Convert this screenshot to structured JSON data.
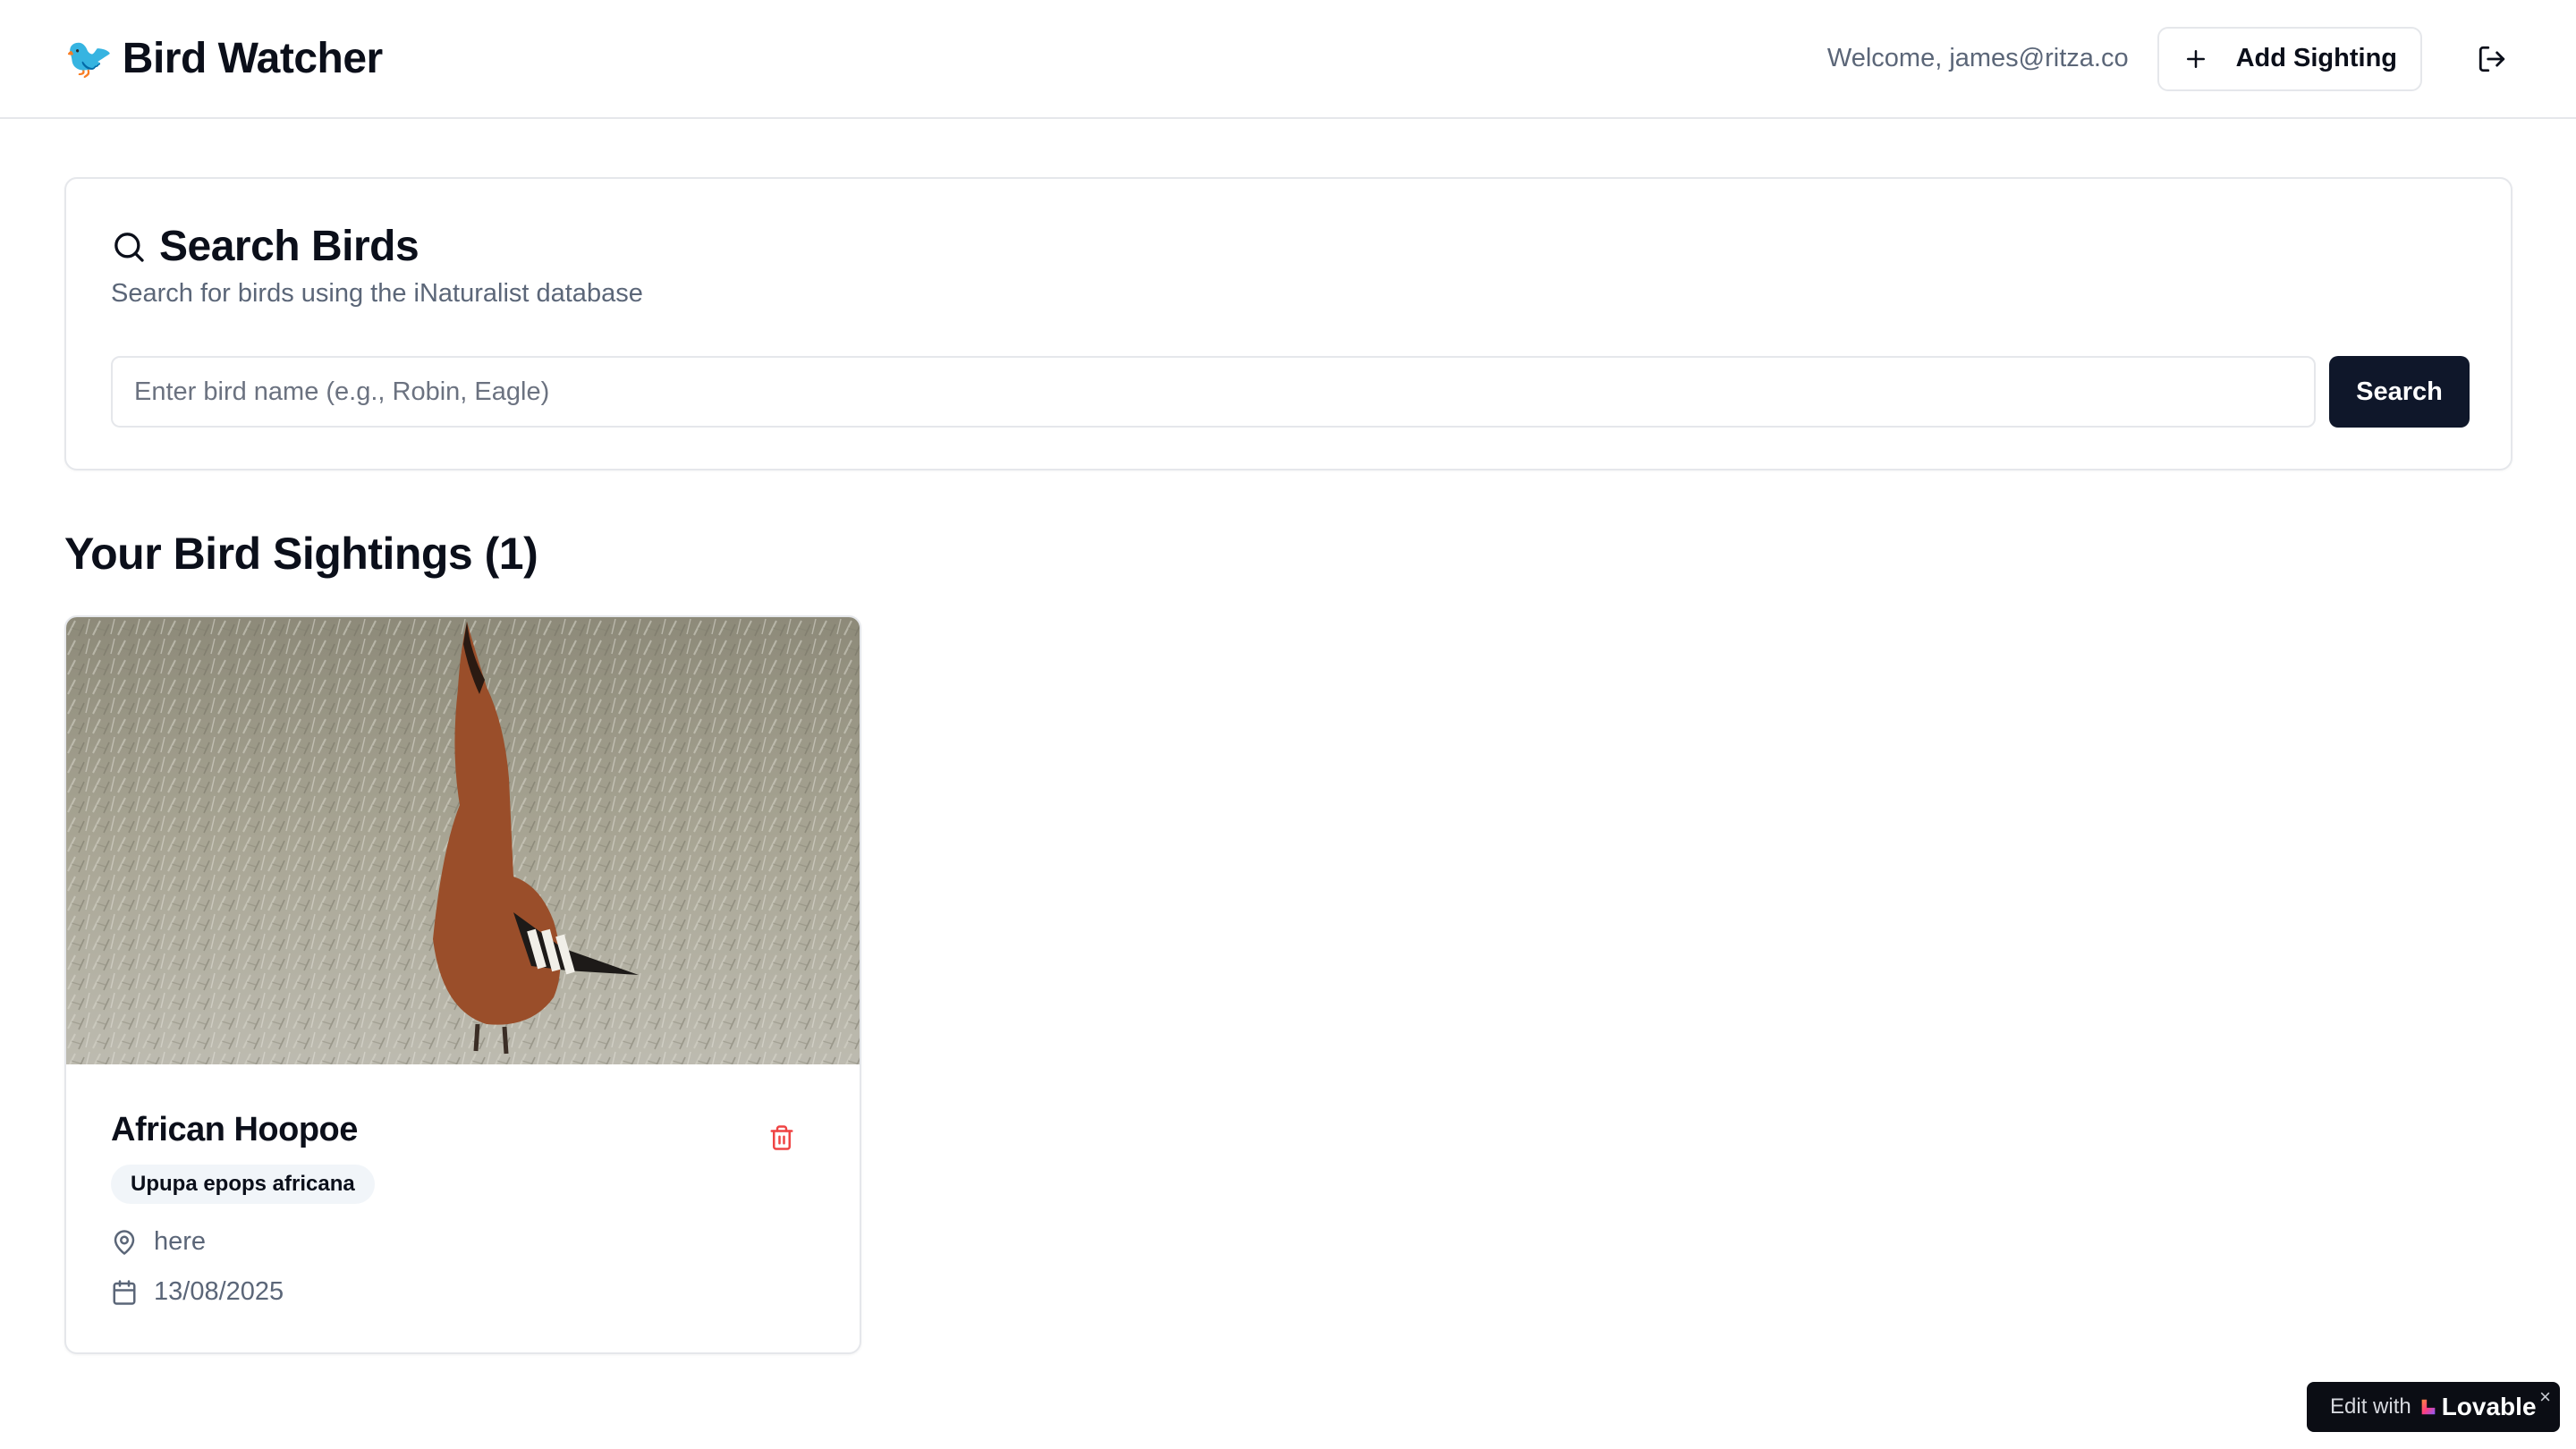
{
  "header": {
    "brand_emoji": "🐦",
    "title": "Bird Watcher",
    "welcome": "Welcome, james@ritza.co",
    "add_sighting_label": "Add Sighting",
    "icons": {
      "add": "plus-icon",
      "logout": "logout-icon"
    }
  },
  "search": {
    "title": "Search Birds",
    "subtitle": "Search for birds using the iNaturalist database",
    "placeholder": "Enter bird name (e.g., Robin, Eagle)",
    "value": "",
    "button_label": "Search",
    "icon": "search-icon"
  },
  "sightings": {
    "heading": "Your Bird Sightings (1)",
    "items": [
      {
        "common_name": "African Hoopoe",
        "scientific_name": "Upupa epops africana",
        "location": "here",
        "date": "13/08/2025",
        "photo": "hoopoe-on-grass-photo",
        "icons": {
          "delete": "trash-icon",
          "location": "map-pin-icon",
          "date": "calendar-icon"
        }
      }
    ]
  },
  "badge": {
    "prefix": "Edit with",
    "brand": "Lovable",
    "close": "×"
  },
  "colors": {
    "primary": "#0f172a",
    "muted_text": "#5b6678",
    "border": "#e5e7eb",
    "danger": "#ef4444",
    "badge_bg": "#f1f5f9"
  }
}
